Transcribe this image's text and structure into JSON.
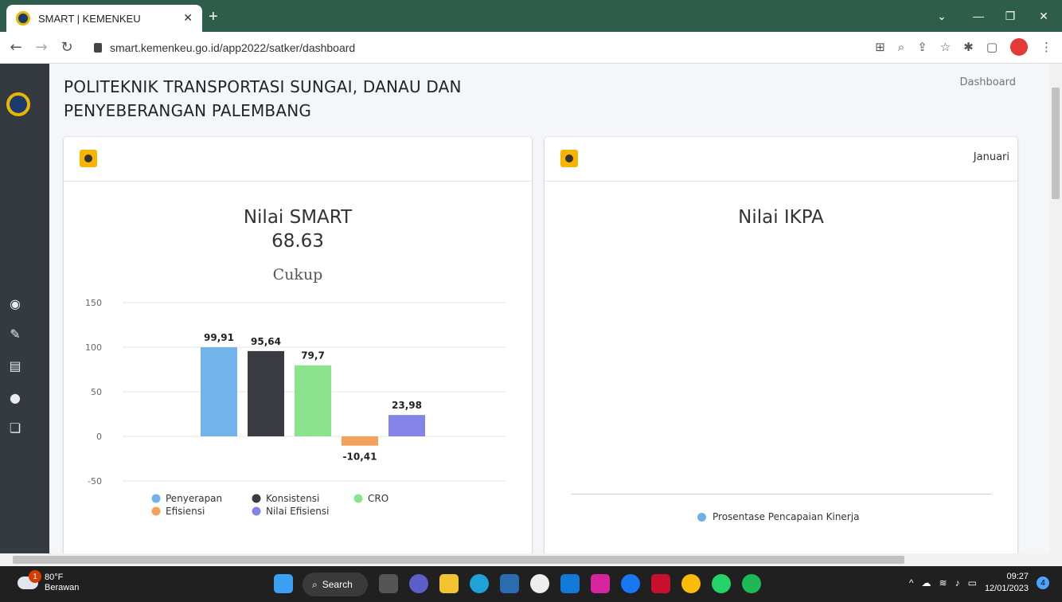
{
  "browser": {
    "tab_title": "SMART | KEMENKEU",
    "url": "smart.kemenkeu.go.id/app2022/satker/dashboard"
  },
  "page": {
    "title_line1": "POLITEKNIK TRANSPORTASI SUNGAI, DANAU DAN",
    "title_line2": "PENYEBERANGAN PALEMBANG",
    "breadcrumb": "Dashboard"
  },
  "smart_card": {
    "title": "Nilai SMART",
    "value": "68.63",
    "category": "Cukup"
  },
  "ikpa_card": {
    "title": "Nilai IKPA",
    "month": "Januari",
    "legend": "Prosentase Pencapaian Kinerja",
    "legend_color": "#6fb0e8"
  },
  "chart_data": {
    "type": "bar",
    "categories": [
      "Penyerapan",
      "Konsistensi",
      "CRO",
      "Efisiensi",
      "Nilai Efisiensi"
    ],
    "values": [
      99.91,
      95.64,
      79.7,
      -10.41,
      23.98
    ],
    "value_labels": [
      "99,91",
      "95,64",
      "79,7",
      "-10,41",
      "23,98"
    ],
    "colors": [
      "#72b3ec",
      "#3b3b44",
      "#8be38b",
      "#f4a15d",
      "#8484e6"
    ],
    "ylim": [
      -50,
      150
    ],
    "yticks": [
      150,
      100,
      50,
      0,
      -50
    ],
    "grid": true,
    "legend_position": "bottom"
  },
  "taskbar": {
    "weather_temp": "80°F",
    "weather_desc": "Berawan",
    "weather_badge": "1",
    "search_label": "Search",
    "time": "09:27",
    "date": "12/01/2023",
    "notification_count": "4"
  }
}
